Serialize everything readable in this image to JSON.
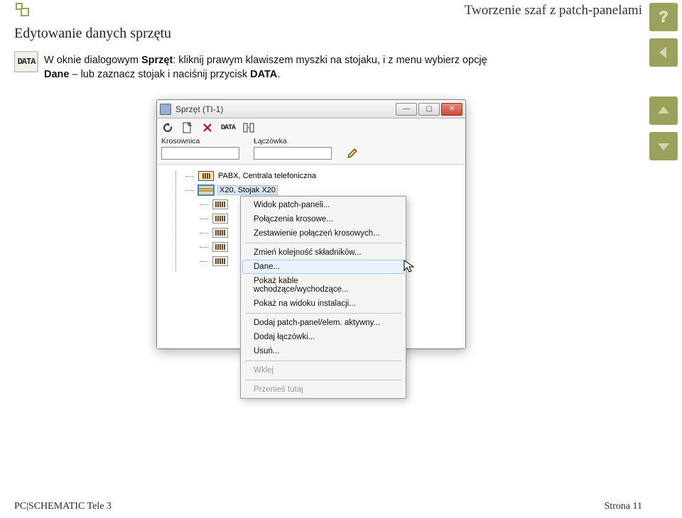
{
  "header": {
    "chapter_title": "Tworzenie szaf z patch-panelami"
  },
  "section": {
    "title": "Edytowanie danych sprzętu"
  },
  "data_chip": {
    "label": "DATA"
  },
  "body": {
    "p1_pre": "W oknie dialogowym ",
    "p1_b1": "Sprzęt",
    "p1_mid": ": kliknij prawym klawiszem myszki na stojaku, i z menu wybierz opcję ",
    "p1_b2": "Dane",
    "p1_post": " – lub zaznacz stojak i naciśnij przycisk ",
    "p1_b3": "DATA",
    "p1_end": "."
  },
  "window": {
    "title": "Sprzęt (TI-1)",
    "toolbar": {
      "refresh_name": "refresh-icon",
      "new_name": "new-doc-icon",
      "delete_name": "delete-icon",
      "data_label": "DATA",
      "split_name": "split-view-icon"
    },
    "fields": {
      "krosownica_label": "Krosownica",
      "laczowka_label": "Łączówka"
    },
    "tree": {
      "node1": "PABX, Centrala telefoniczna",
      "node2": "X20, Stojak X20"
    },
    "context_menu": {
      "items": [
        "Widok patch-paneli...",
        "Połączenia krosowe...",
        "Zestawienie połączeń krosowych...",
        "Zmień kolejność składników...",
        "Dane...",
        "Pokaż kable wchodzące/wychodzące...",
        "Pokaż na widoku instalacji...",
        "Dodaj patch-panel/elem. aktywny...",
        "Dodaj łączówki...",
        "Usuń...",
        "Wklej",
        "Przenieś tutaj"
      ]
    }
  },
  "footer": {
    "left": "PC|SCHEMATIC Tele 3",
    "right": "Strona 11"
  }
}
